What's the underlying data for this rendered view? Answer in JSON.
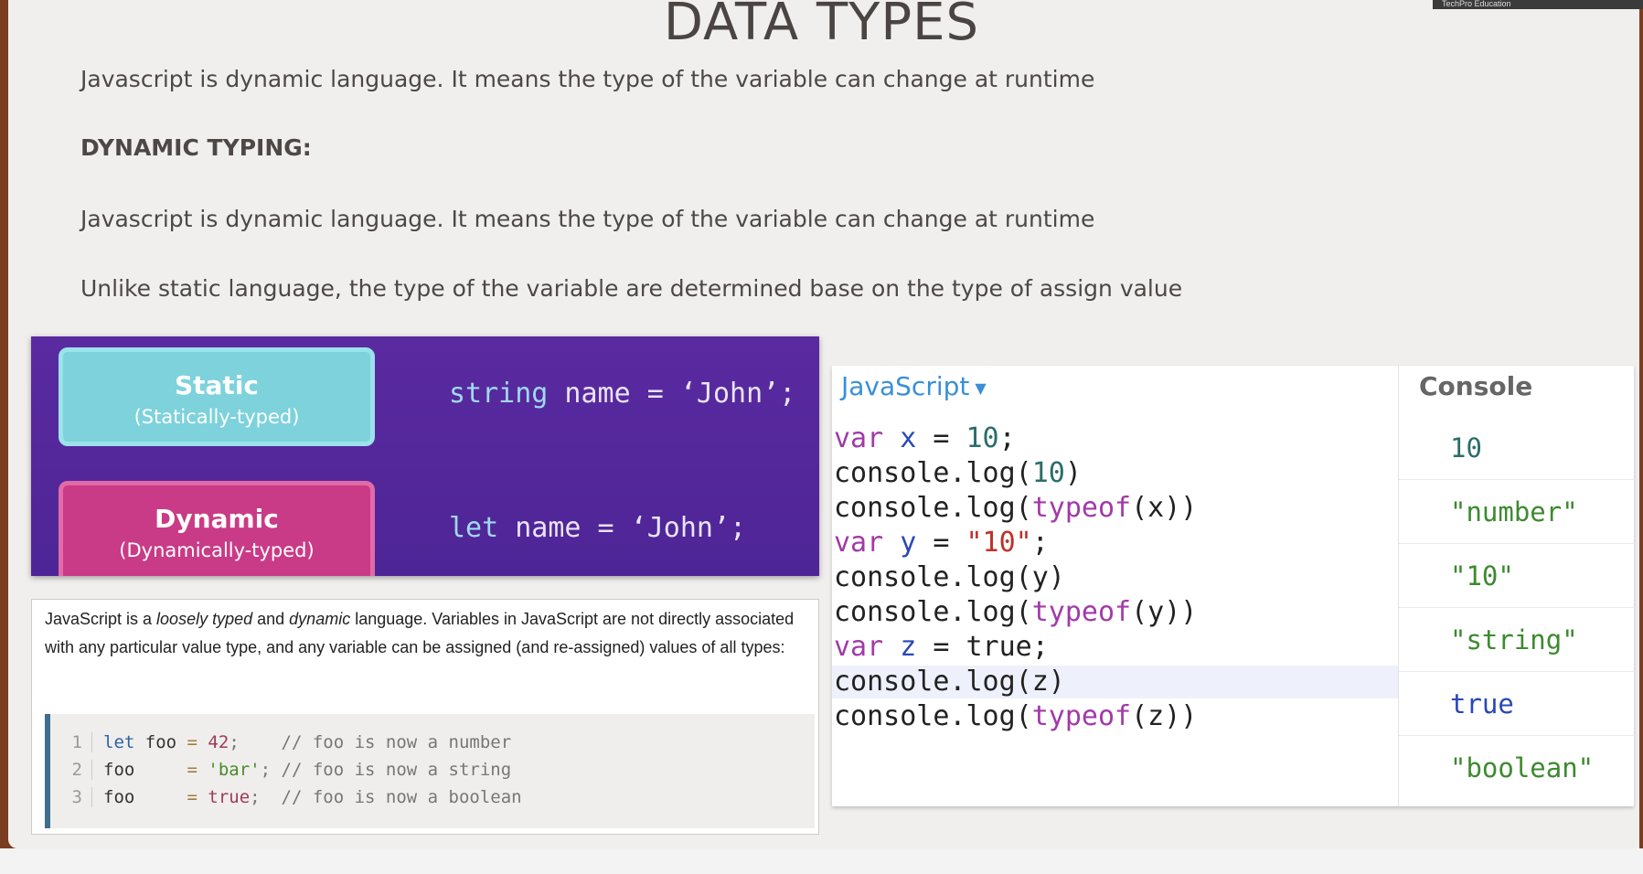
{
  "slide": {
    "title": "DATA TYPES",
    "line1": "Javascript is dynamic language. It means the type of the variable can change at runtime",
    "heading": "DYNAMIC TYPING:",
    "line2": "Javascript is dynamic language. It means the type of the variable can change at runtime",
    "line3": "Unlike static language, the type of the variable are determined base on the type of assign value"
  },
  "webcam": {
    "label": "TechPro Education"
  },
  "typing": {
    "static_title": "Static",
    "static_sub": "(Statically-typed)",
    "static_kw": "string",
    "static_code": " name = ‘John’;",
    "dynamic_title": "Dynamic",
    "dynamic_sub": "(Dynamically-typed)",
    "dynamic_kw": "let",
    "dynamic_code": " name = ‘John’;"
  },
  "mdn": {
    "t1": "JavaScript is a ",
    "t2": "loosely typed",
    "t3": " and ",
    "t4": "dynamic",
    "t5": " language. Variables in JavaScript are not directly associated with any particular value type, and any variable can be assigned (and re-assigned) values of all types:",
    "lines": [
      {
        "n": "1",
        "a": "let",
        "b": " foo ",
        "op": "=",
        "v": " 42",
        "semi": ";    ",
        "c": "// foo is now a number"
      },
      {
        "n": "2",
        "a": "",
        "b": "foo     ",
        "op": "=",
        "v": " 'bar'",
        "semi": "; ",
        "c": "// foo is now a string"
      },
      {
        "n": "3",
        "a": "",
        "b": "foo     ",
        "op": "=",
        "v": " true",
        "semi": ";  ",
        "c": "// foo is now a boolean"
      }
    ]
  },
  "editor": {
    "language": "JavaScript",
    "console_title": "Console",
    "code": [
      [
        "var",
        " ",
        "x",
        " = ",
        "10",
        ";"
      ],
      [
        "",
        "console.log(",
        "",
        "",
        "10",
        ")"
      ],
      [
        "",
        "console.log(",
        "typeof",
        "(x))",
        "",
        ""
      ],
      [
        "var",
        " ",
        "y",
        " = ",
        "\"10\"",
        ";"
      ],
      [
        "",
        "console.log(y)",
        "",
        "",
        "",
        ""
      ],
      [
        "",
        "console.log(",
        "typeof",
        "(y))",
        "",
        ""
      ],
      [
        "var",
        " ",
        "z",
        " = true;",
        "",
        ""
      ],
      [
        "",
        "console.log(z)",
        "",
        "",
        "",
        ""
      ],
      [
        "",
        "console.log(",
        "typeof",
        "(z))",
        "",
        ""
      ]
    ],
    "output": [
      "10",
      "\"number\"",
      "\"10\"",
      "\"string\"",
      "true",
      "\"boolean\""
    ]
  }
}
